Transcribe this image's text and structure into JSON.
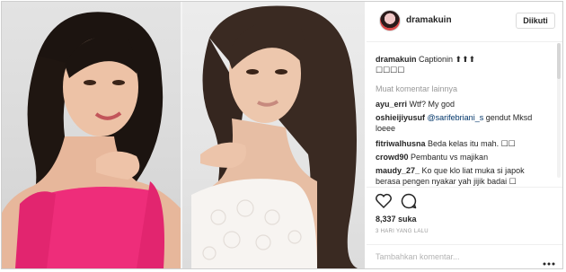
{
  "post": {
    "username": "dramakuin",
    "follow_label": "Diikuti",
    "caption_user": "dramakuin",
    "caption_text": "Captionin ⬆⬆⬆",
    "caption_line2": "☐☐☐☐",
    "load_more": "Muat komentar lainnya",
    "comments": [
      {
        "user": "ayu_erri",
        "text": "Wtf? My god"
      },
      {
        "user": "oshieijiyusuf",
        "mention": "@sarifebriani_s",
        "text": "gendut Mksd",
        "cont": "loeee"
      },
      {
        "user": "fitriwalhusna",
        "text": "Beda kelas itu mah. ☐☐"
      },
      {
        "user": "crowd90",
        "text": "Pembantu vs majikan"
      },
      {
        "user": "maudy_27_",
        "text": "Ko que klo liat muka si japok",
        "cont": "berasa pengen nyakar yah jijik badai ☐"
      }
    ],
    "likes": "8,337 suka",
    "date": "3 HARI YANG LALU",
    "comment_placeholder": "Tambahkan komentar...",
    "icons": [
      "heart-icon",
      "comment-icon",
      "more-options-icon"
    ]
  }
}
